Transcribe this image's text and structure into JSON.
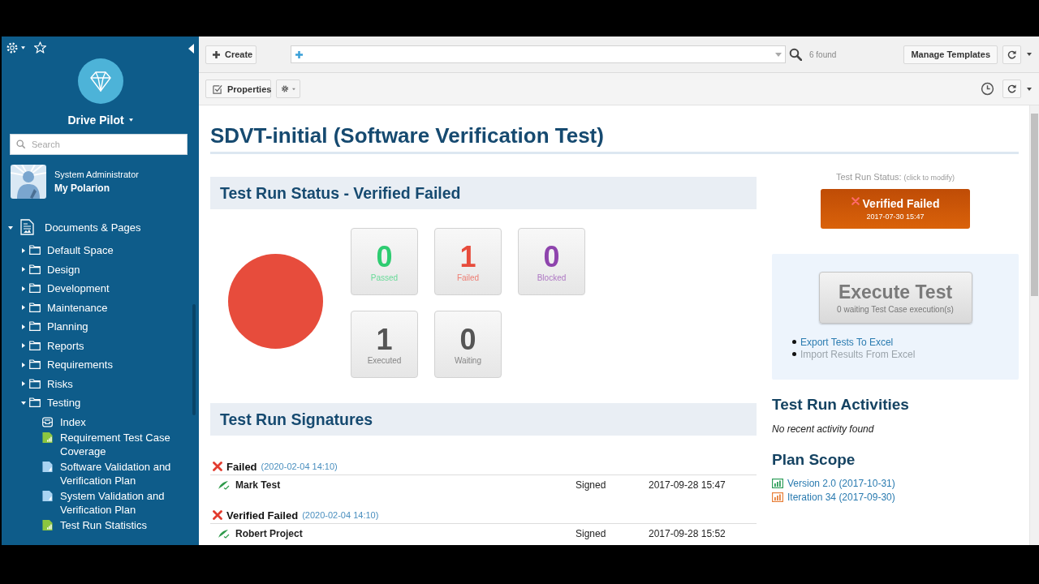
{
  "sidebar": {
    "project": "Drive Pilot",
    "search": {
      "placeholder": "Search"
    },
    "user": {
      "role": "System Administrator",
      "name": "My Polarion"
    },
    "tree": [
      {
        "label": "Documents & Pages",
        "kind": "space",
        "expanded": true,
        "children": [
          {
            "label": "Default Space",
            "kind": "folder",
            "expanded": false
          },
          {
            "label": "Design",
            "kind": "folder",
            "expanded": false
          },
          {
            "label": "Development",
            "kind": "folder",
            "expanded": false
          },
          {
            "label": "Maintenance",
            "kind": "folder",
            "expanded": false
          },
          {
            "label": "Planning",
            "kind": "folder",
            "expanded": false
          },
          {
            "label": "Reports",
            "kind": "folder",
            "expanded": false
          },
          {
            "label": "Requirements",
            "kind": "folder",
            "expanded": false
          },
          {
            "label": "Risks",
            "kind": "folder",
            "expanded": false
          },
          {
            "label": "Testing",
            "kind": "folder",
            "expanded": true,
            "children": [
              {
                "label": "Index",
                "kind": "index"
              },
              {
                "label": "Requirement Test Case Coverage",
                "kind": "report"
              },
              {
                "label": "Software Validation and Verification Plan",
                "kind": "document"
              },
              {
                "label": "System Validation and Verification Plan",
                "kind": "document"
              },
              {
                "label": "Test Run Statistics",
                "kind": "report"
              }
            ]
          }
        ]
      }
    ]
  },
  "toolbar": {
    "create": "Create",
    "result_count": "6 found",
    "manage_templates": "Manage Templates"
  },
  "subtoolbar": {
    "properties": "Properties"
  },
  "page": {
    "title": "SDVT-initial (Software Verification Test)",
    "status": {
      "heading": "Test Run Status - Verified Failed",
      "stats": [
        {
          "value": "0",
          "label": "Passed",
          "color": "#2ecc71"
        },
        {
          "value": "1",
          "label": "Failed",
          "color": "#e74c3c"
        },
        {
          "value": "0",
          "label": "Blocked",
          "color": "#8e44ad"
        },
        {
          "value": "1",
          "label": "Executed",
          "color": "#555555"
        },
        {
          "value": "0",
          "label": "Waiting",
          "color": "#555555"
        }
      ]
    },
    "signatures": {
      "heading": "Test Run Signatures",
      "groups": [
        {
          "status": "Failed",
          "date": "(2020-02-04 14:10)",
          "signers": [
            {
              "name": "Mark Test",
              "state": "Signed",
              "date": "2017-09-28 15:47"
            }
          ]
        },
        {
          "status": "Verified Failed",
          "date": "(2020-02-04 14:10)",
          "signers": [
            {
              "name": "Robert Project",
              "state": "Signed",
              "date": "2017-09-28 15:52"
            }
          ]
        }
      ]
    },
    "status_control": {
      "label": "Test Run Status:",
      "hint": "(click to modify)",
      "value": "Verified Failed",
      "date": "2017-07-30 15:47"
    },
    "execute": {
      "label": "Execute Test",
      "detail": "0 waiting Test Case execution(s)",
      "actions": [
        {
          "label": "Export Tests To Excel",
          "disabled": false
        },
        {
          "label": "Import Results From Excel",
          "disabled": true
        }
      ]
    },
    "activities": {
      "heading": "Test Run Activities",
      "empty": "No recent activity found"
    },
    "plan_scope": {
      "heading": "Plan Scope",
      "items": [
        {
          "label": "Version 2.0 (2017-10-31)",
          "color": "#2f9e5a"
        },
        {
          "label": "Iteration 34 (2017-09-30)",
          "color": "#e8803a"
        }
      ]
    }
  }
}
